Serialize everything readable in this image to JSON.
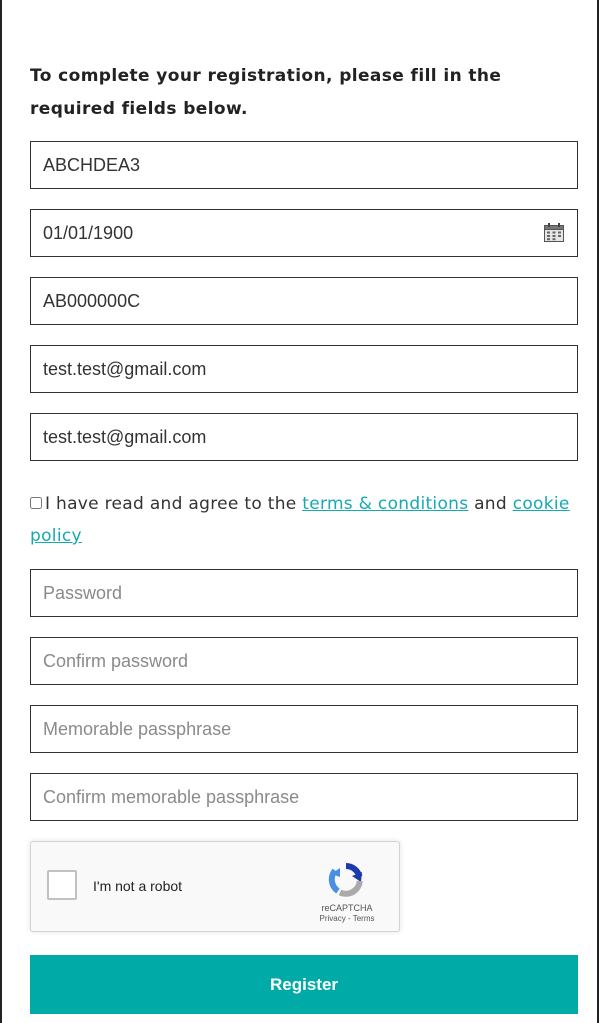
{
  "intro_text": "To complete your registration, please fill in the required fields below.",
  "fields": {
    "reference": {
      "value": "ABCHDEA3"
    },
    "date_of_birth": {
      "value": "01/01/1900"
    },
    "ni_number": {
      "value": "AB000000C"
    },
    "email": {
      "value": "test.test@gmail.com"
    },
    "confirm_email": {
      "value": "test.test@gmail.com"
    },
    "password": {
      "placeholder": "Password"
    },
    "confirm_password": {
      "placeholder": "Confirm password"
    },
    "passphrase": {
      "placeholder": "Memorable passphrase"
    },
    "confirm_passphrase": {
      "placeholder": "Confirm memorable passphrase"
    }
  },
  "consent": {
    "prefix": "I have read and agree to the ",
    "terms_link": "terms & conditions",
    "middle": " and ",
    "cookie_link": "cookie policy"
  },
  "recaptcha": {
    "label": "I'm not a robot",
    "brand": "reCAPTCHA",
    "privacy": "Privacy",
    "separator": " - ",
    "terms": "Terms"
  },
  "register_label": "Register",
  "colors": {
    "accent": "#00aaa7",
    "link": "#17a9b2",
    "border": "#333333"
  },
  "icons": {
    "calendar": "calendar-icon",
    "recaptcha": "recaptcha-logo-icon"
  }
}
